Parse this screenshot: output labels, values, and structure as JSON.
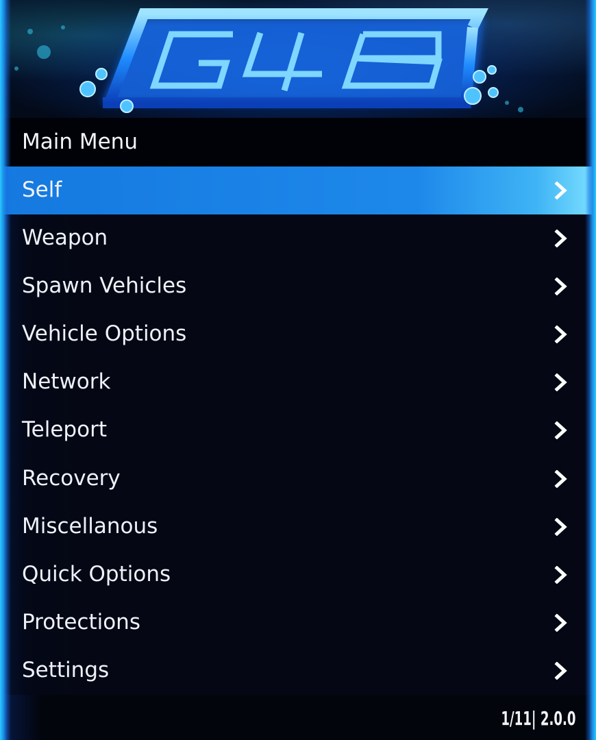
{
  "banner": {
    "logo_text": "G4B"
  },
  "menu": {
    "title": "Main Menu",
    "selected_index": 0,
    "items": [
      {
        "label": "Self"
      },
      {
        "label": "Weapon"
      },
      {
        "label": "Spawn Vehicles"
      },
      {
        "label": "Vehicle Options"
      },
      {
        "label": "Network"
      },
      {
        "label": "Teleport"
      },
      {
        "label": "Recovery"
      },
      {
        "label": "Miscellanous"
      },
      {
        "label": "Quick Options"
      },
      {
        "label": "Protections"
      },
      {
        "label": "Settings"
      }
    ],
    "footer": "1/11| 2.0.0"
  },
  "colors": {
    "accent": "#1e88ea",
    "glow": "#29c9ff",
    "background": "#050814"
  },
  "icons": {
    "item_arrow": "chevron-right-icon"
  }
}
